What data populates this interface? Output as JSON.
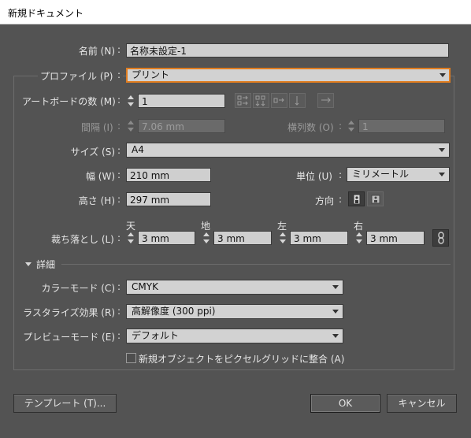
{
  "window": {
    "title": "新規ドキュメント"
  },
  "name": {
    "label": "名前 (N)",
    "value": "名称未設定-1"
  },
  "profile": {
    "label": "プロファイル (P)",
    "value": "プリント"
  },
  "artboards": {
    "label": "アートボードの数 (M)",
    "value": "1",
    "spacing_label": "間隔 (I)",
    "spacing_value": "7.06 mm",
    "columns_label": "横列数 (O)",
    "columns_value": "1"
  },
  "size": {
    "label": "サイズ (S)",
    "value": "A4"
  },
  "width": {
    "label": "幅 (W)",
    "value": "210 mm"
  },
  "height": {
    "label": "高さ (H)",
    "value": "297 mm"
  },
  "units": {
    "label": "単位 (U)",
    "value": "ミリメートル"
  },
  "orientation": {
    "label": "方向"
  },
  "bleed": {
    "label": "裁ち落とし (L)",
    "top_label": "天",
    "top_value": "3 mm",
    "bottom_label": "地",
    "bottom_value": "3 mm",
    "left_label": "左",
    "left_value": "3 mm",
    "right_label": "右",
    "right_value": "3 mm"
  },
  "advanced": {
    "label": "詳細"
  },
  "color_mode": {
    "label": "カラーモード (C)",
    "value": "CMYK"
  },
  "raster_effects": {
    "label": "ラスタライズ効果 (R)",
    "value": "高解像度 (300 ppi)"
  },
  "preview_mode": {
    "label": "プレビューモード (E)",
    "value": "デフォルト"
  },
  "align_pixel_grid": {
    "label": "新規オブジェクトをピクセルグリッドに整合 (A)",
    "checked": false
  },
  "buttons": {
    "templates": "テンプレート (T)...",
    "ok": "OK",
    "cancel": "キャンセル"
  },
  "colors": {
    "panel": "#535353",
    "field": "#cfcfcf",
    "focus_accent": "#e07d20",
    "title_bar": "#ffffff"
  }
}
